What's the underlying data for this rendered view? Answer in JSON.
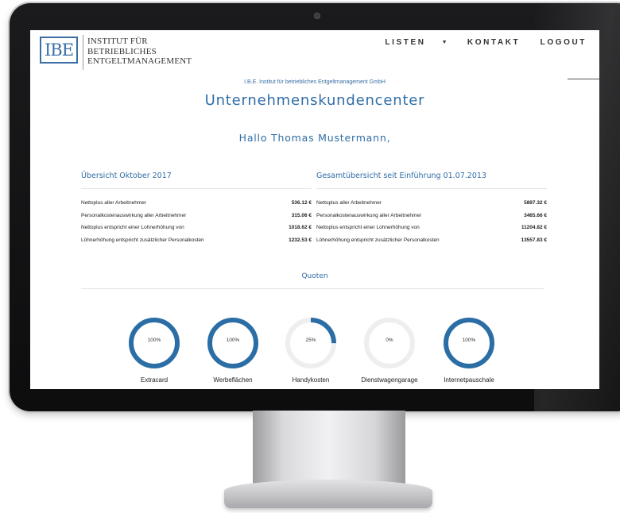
{
  "logo": {
    "mark": "IBE",
    "lines": [
      "Institut für",
      "Betriebliches",
      "Entgeltmanagement"
    ]
  },
  "nav": {
    "listen": "LISTEN",
    "kontakt": "KONTAKT",
    "logout": "LOGOUT"
  },
  "header": {
    "org": "I.B.E. Institut für betriebliches Entgeltmanagement GmbH",
    "title": "Unternehmenskundencenter",
    "greeting": "Hallo Thomas Mustermann,"
  },
  "overview_month": {
    "title": "Übersicht Oktober 2017",
    "rows": [
      {
        "label": "Nettoplus aller Arbeitnehmer",
        "value": "536.12 €"
      },
      {
        "label": "Personalkostenauswirkung aller Arbeitnehmer",
        "value": "315.06 €"
      },
      {
        "label": "Nettoplus entspricht einer Lohnerhöhung von",
        "value": "1018.62 €"
      },
      {
        "label": "Löhnerhöhung entspricht zusätzlicher Personalkosten",
        "value": "1232.53 €"
      }
    ]
  },
  "overview_total": {
    "title": "Gesamtübersicht seit Einführung 01.07.2013",
    "rows": [
      {
        "label": "Nettoplus aller Arbeitnehmer",
        "value": "5897.32 €"
      },
      {
        "label": "Personalkostenauswirkung aller Arbeitnehmer",
        "value": "3465.66 €"
      },
      {
        "label": "Nettoplus entspricht einer Lohnerhöhung von",
        "value": "11204.82 €"
      },
      {
        "label": "Löhnerhöhung entspricht zusätzlicher Personalkosten",
        "value": "13557.83 €"
      }
    ]
  },
  "quoten": {
    "title": "Quoten",
    "items": [
      {
        "label": "Extracard",
        "percent_text": "100%",
        "fraction": 1.0
      },
      {
        "label": "Werbeflächen",
        "percent_text": "100%",
        "fraction": 1.0
      },
      {
        "label": "Handykosten",
        "percent_text": "25%",
        "fraction": 0.25
      },
      {
        "label": "Dienstwagengarage",
        "percent_text": "0%",
        "fraction": 0.0
      },
      {
        "label": "Internetpauschale",
        "percent_text": "100%",
        "fraction": 1.0
      }
    ]
  },
  "colors": {
    "accent": "#2f6da6",
    "ring_fill": "#2b6ea6",
    "ring_track": "#eeeeee"
  }
}
